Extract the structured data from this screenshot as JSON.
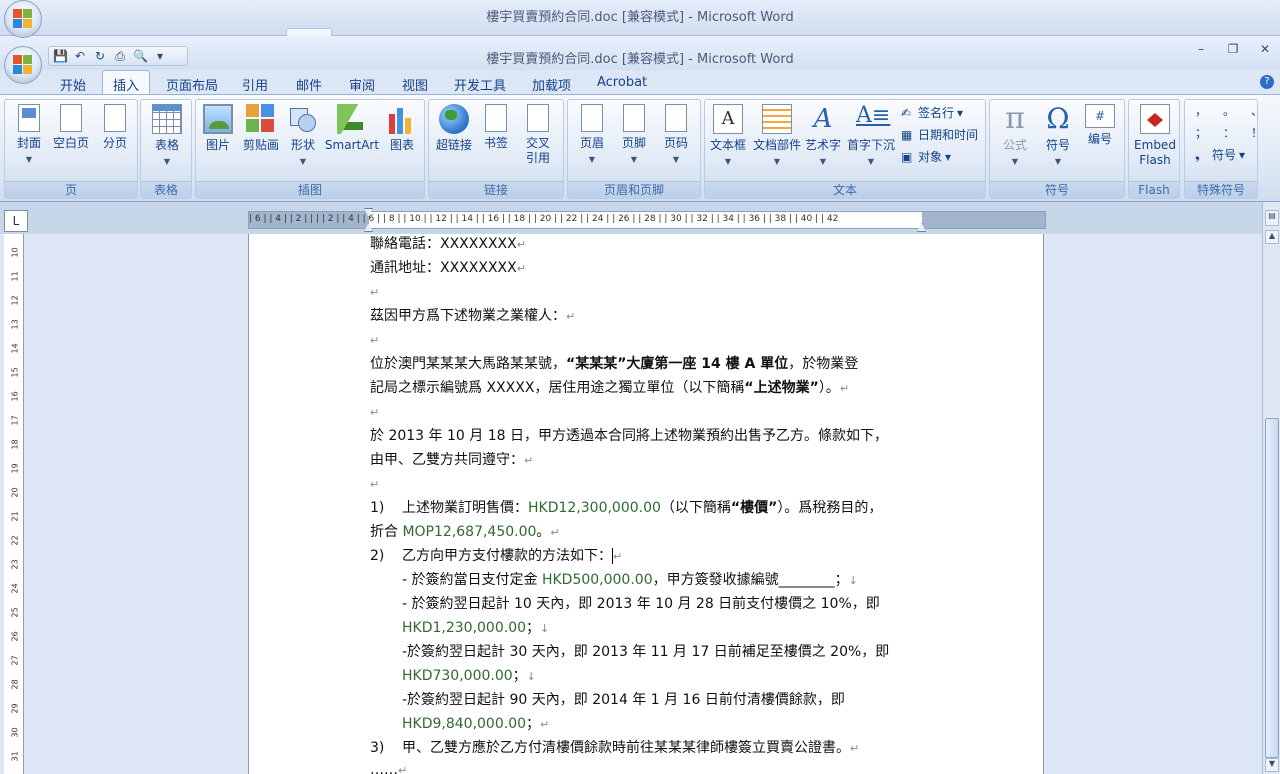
{
  "background_window": {
    "title": "樓宇買賣預約合同.doc [兼容模式] - Microsoft Word"
  },
  "window": {
    "title": "樓宇買賣預約合同.doc [兼容模式] - Microsoft Word",
    "controls": {
      "minimize": "–",
      "restore": "❐",
      "close": "✕"
    }
  },
  "tabs": [
    "开始",
    "插入",
    "页面布局",
    "引用",
    "邮件",
    "审阅",
    "视图",
    "开发工具",
    "加载项",
    "Acrobat"
  ],
  "active_tab": "插入",
  "ribbon": {
    "groups": {
      "pages": {
        "label": "页",
        "buttons": [
          "封面",
          "空白页",
          "分页"
        ]
      },
      "tables": {
        "label": "表格",
        "buttons": [
          "表格"
        ]
      },
      "illustrations": {
        "label": "插图",
        "buttons": [
          "图片",
          "剪贴画",
          "形状",
          "SmartArt",
          "图表"
        ]
      },
      "links": {
        "label": "链接",
        "buttons": [
          "超链接",
          "书签",
          "交叉",
          "引用"
        ]
      },
      "header_footer": {
        "label": "页眉和页脚",
        "buttons": [
          "页眉",
          "页脚",
          "页码"
        ]
      },
      "text": {
        "label": "文本",
        "buttons": [
          "文本框",
          "文档部件",
          "艺术字",
          "首字下沉"
        ],
        "small": [
          "签名行",
          "日期和时间",
          "对象"
        ]
      },
      "symbols": {
        "label": "符号",
        "buttons": [
          "公式",
          "符号",
          "编号"
        ]
      },
      "flash": {
        "label": "Flash",
        "buttons": [
          "Embed",
          "Flash"
        ]
      },
      "special": {
        "label": "特殊符号",
        "small": [
          "，",
          "。",
          "、",
          "；",
          "：",
          "！",
          "符号"
        ]
      }
    }
  },
  "ruler": {
    "corner": "L",
    "ticks": "| 6 |  | 4 |  | 2 |  |  |  | 2 |  | 4 |  | 6 |  | 8 |  | 10 |  | 12 |  | 14 |  | 16 |  | 18 |  | 20 |  | 22 |  | 24 |  | 26 |  | 28 |  | 30 |  | 32 |  | 34 |  | 36 |  | 38 |  | 40 |  | 42",
    "vertical": [
      "10",
      "11",
      "12",
      "13",
      "14",
      "15",
      "16",
      "17",
      "18",
      "19",
      "20",
      "21",
      "22",
      "23",
      "24",
      "25",
      "26",
      "27",
      "28",
      "29",
      "30",
      "31"
    ]
  },
  "document": {
    "l1": "聯絡電話：XXXXXXXX",
    "l2": "通訊地址：XXXXXXXX",
    "l4": "茲因甲方爲下述物業之業權人：",
    "l6a": "位於澳門某某某大馬路某某號，",
    "l6b": "“某某某”大廈第一座 14 樓 A 單位",
    "l6c": "，於物業登",
    "l7a": "記局之標示編號爲 XXXXX，居住用途之獨立單位（以下簡稱",
    "l7b": "“上述物業”",
    "l7c": "）。",
    "l9": "於 2013 年 10 月 18 日，甲方透過本合同將上述物業預約出售予乙方。條款如下，",
    "l10": "由甲、乙雙方共同遵守：",
    "i1_num": "1)",
    "i1a": "上述物業訂明售價：",
    "i1b": "HKD12,300,000.00",
    "i1c": "（以下簡稱",
    "i1d": "“樓價”",
    "i1e": "）。爲稅務目的，",
    "i1f": "折合 ",
    "i1g": "MOP12,687,450.00",
    "i1h": "。",
    "i2_num": "2)",
    "i2": "乙方向甲方支付樓款的方法如下：",
    "s1a": "- 於簽約當日支付定金 ",
    "s1b": "HKD500,000.00",
    "s1c": "，甲方簽發收據編號",
    "s1d": "________",
    "s1e": "；",
    "s2a": "- 於簽約翌日起計 10 天內，即 2013 年 10 月 28 日前支付樓價之 10%，即",
    "s2b": "HKD1,230,000.00",
    "s2c": "；",
    "s3a": "-於簽約翌日起計 30 天內，即 2013 年 11 月 17 日前補足至樓價之 20%，即",
    "s3b": "HKD730,000.00",
    "s3c": "；",
    "s4a": "-於簽約翌日起計 90 天內，即 2014 年 1 月 16 日前付清樓價餘款，即",
    "s4b": "HKD9,840,000.00",
    "s4c": "；",
    "i3_num": "3)",
    "i3": "甲、乙雙方應於乙方付清樓價餘款時前往某某某律師樓簽立買賣公證書。",
    "l_end": "……",
    "para_mark": "↵",
    "line_mark": "↓"
  }
}
